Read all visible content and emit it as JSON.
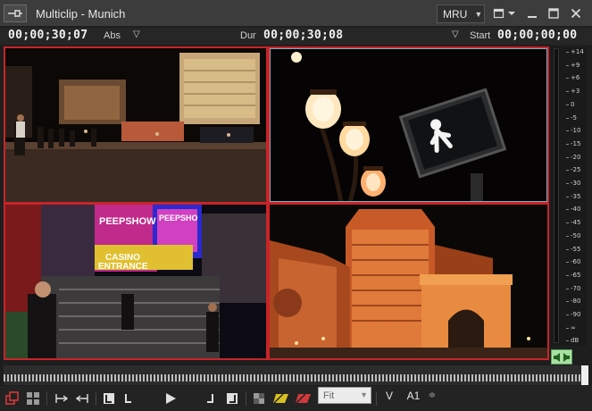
{
  "window": {
    "title": "Multiclip - Munich",
    "mru_label": "MRU"
  },
  "timecode_bar": {
    "position": "00;00;30;07",
    "position_mode": "Abs",
    "duration_label": "Dur",
    "duration": "00;00;30;08",
    "start_label": "Start",
    "start": "00;00;00;00"
  },
  "multiclip": {
    "active_angle": 2,
    "angles": [
      {
        "scene": "Las Vegas Strip street at night with pedestrians and lit hotels"
      },
      {
        "scene": "Ornate street lamps and pedestrian walk signal"
      },
      {
        "scene": "Casino entrance with neon signs and stairway",
        "signs": [
          "PEEPSHOW",
          "PEEPSHO",
          "CASINO",
          "ENTRANCE"
        ]
      },
      {
        "scene": "Paris hotel facade and Arc de Triomphe replica lit at night"
      }
    ]
  },
  "audio_meter": {
    "scale": [
      "+14",
      "+9",
      "+6",
      "+3",
      "0",
      "-5",
      "-10",
      "-15",
      "-20",
      "-25",
      "-30",
      "-35",
      "-40",
      "-45",
      "-50",
      "-55",
      "-60",
      "-65",
      "-70",
      "-80",
      "-90",
      "∞",
      "dB"
    ]
  },
  "toolbar": {
    "fit_value": "Fit",
    "v_label": "V",
    "a_label": "A1"
  },
  "colors": {
    "window_bg": "#1e1e1e",
    "title_bg": "#3c3c3c",
    "active_border": "#c8242a",
    "selected_angle": "#7fb0c0",
    "audio_toggle": "#a8e0a0"
  }
}
